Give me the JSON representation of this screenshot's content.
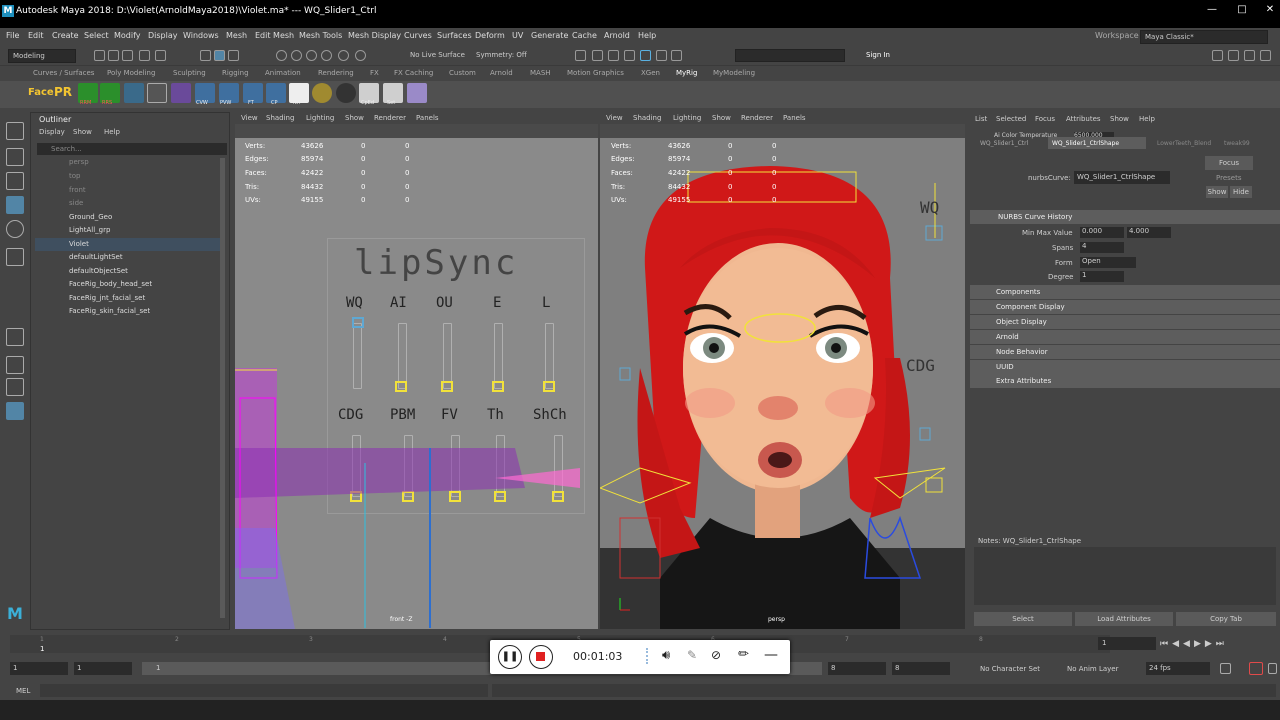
{
  "window": {
    "title": "Autodesk Maya 2018: D:\\Violet(ArnoldMaya2018)\\Violet.ma*  ---  WQ_Slider1_Ctrl",
    "min": "—",
    "max": "□",
    "close": "✕"
  },
  "menus": [
    "File",
    "Edit",
    "Create",
    "Select",
    "Modify",
    "Display",
    "Windows",
    "Mesh",
    "Edit Mesh",
    "Mesh Tools",
    "Mesh Display",
    "Curves",
    "Surfaces",
    "Deform",
    "UV",
    "Generate",
    "Cache",
    "Arnold",
    "Help"
  ],
  "workspace": {
    "label": "Workspace :",
    "value": "Maya Classic*"
  },
  "status": {
    "mode": "Modeling",
    "live": "No Live Surface",
    "symmetry": "Symmetry: Off",
    "signin": "Sign In"
  },
  "shelf_tabs": [
    "Curves / Surfaces",
    "Poly Modeling",
    "Sculpting",
    "Rigging",
    "Animation",
    "Rendering",
    "FX",
    "FX Caching",
    "Custom",
    "Arnold",
    "MASH",
    "Motion Graphics",
    "XGen",
    "MyRig",
    "MyModeling"
  ],
  "shelf_labels": {
    "face": "Face",
    "pr": "PR",
    "rrm": "RRM",
    "rrs": "RRS",
    "cvw": "CVW",
    "pvw": "PVW",
    "ft": "FT",
    "cp": "CP",
    "nh": "NH",
    "cpd": "CpEd",
    "set": "Set"
  },
  "outliner": {
    "title": "Outliner",
    "menus": [
      "Display",
      "Show",
      "Help"
    ],
    "search": "Search...",
    "items": [
      "persp",
      "top",
      "front",
      "side",
      "Ground_Geo",
      "LightAll_grp",
      "Violet",
      "defaultLightSet",
      "defaultObjectSet",
      "FaceRig_body_head_set",
      "FaceRig_jnt_facial_set",
      "FaceRig_skin_facial_set"
    ]
  },
  "viewport_menu": [
    "View",
    "Shading",
    "Lighting",
    "Show",
    "Renderer",
    "Panels"
  ],
  "hud": {
    "rows": [
      "Verts:",
      "Edges:",
      "Faces:",
      "Tris:",
      "UVs:"
    ],
    "vals": [
      "43626",
      "85974",
      "42422",
      "84432",
      "49155"
    ],
    "zeros": "0"
  },
  "front_label": "front -Z",
  "persp_label": "persp",
  "lipsync": {
    "title": "lipSync",
    "row1": [
      "WQ",
      "AI",
      "OU",
      "E",
      "L"
    ],
    "row2": [
      "CDG",
      "PBM",
      "FV",
      "Th",
      "ShCh"
    ]
  },
  "persp_labels": {
    "wq": "WQ",
    "cdg": "CDG"
  },
  "attr": {
    "menus": [
      "List",
      "Selected",
      "Focus",
      "Attributes",
      "Show",
      "Help"
    ],
    "tabs": [
      "WQ_Slider1_Ctrl",
      "WQ_Slider1_CtrlShape",
      "LowerTeeth_Blend",
      "tweak99"
    ],
    "aicolor": "Ai Color Temperature",
    "aicolor_val": "6500.000",
    "node_label": "nurbsCurve:",
    "node_value": "WQ_Slider1_CtrlShape",
    "focus": "Focus",
    "presets": "Presets",
    "show": "Show",
    "hide": "Hide",
    "history": "NURBS Curve History",
    "minmax": "Min Max Value",
    "min": "0.000",
    "max": "4.000",
    "spans": "Spans",
    "spans_v": "4",
    "form": "Form",
    "form_v": "Open",
    "degree": "Degree",
    "degree_v": "1",
    "sections": [
      "Components",
      "Component Display",
      "Object Display",
      "Arnold",
      "Node Behavior",
      "UUID",
      "Extra Attributes"
    ],
    "notes": "Notes: WQ_Slider1_CtrlShape",
    "buttons": [
      "Select",
      "Load Attributes",
      "Copy Tab"
    ]
  },
  "timeline": {
    "ticks": [
      "1",
      "2",
      "3",
      "4",
      "5",
      "6",
      "7",
      "8"
    ],
    "current": "1"
  },
  "range": {
    "start": "1",
    "start2": "1",
    "slider": "1",
    "end": "8",
    "end2": "8",
    "charset": "No Character Set",
    "animlayer": "No Anim Layer",
    "fps": "24 fps"
  },
  "recorder": {
    "time": "00:01:03"
  },
  "cmd": {
    "label": "MEL"
  }
}
